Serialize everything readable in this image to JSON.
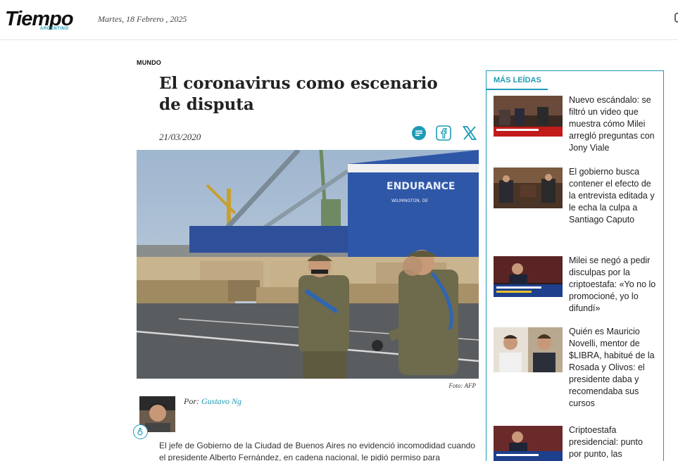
{
  "header": {
    "logo_text": "Tiempo",
    "logo_subtext": "ARGENTINO",
    "date": "Martes, 18 Febrero , 2025"
  },
  "article": {
    "section": "MUNDO",
    "title": "El coronavirus como escenario de disputa",
    "date": "21/03/2020",
    "image_caption": "Foto: AFP",
    "image_ship_name": "ENDURANCE",
    "image_ship_port": "WILMINGTON, DE",
    "author_prefix": "Por:",
    "author_name": "Gustavo Ng",
    "body": "El jefe de Gobierno de la Ciudad de Buenos Aires no evidenció incomodidad cuando el presidente Alberto Fernández, en cadena nacional, le pidió permiso para"
  },
  "share": {
    "icons": [
      "comments-icon",
      "facebook-icon",
      "x-icon"
    ]
  },
  "sidebar": {
    "title": "MÁS LEÍDAS",
    "items": [
      {
        "text": "Nuevo escándalo: se filtró un video que muestra cómo Milei arregló preguntas con Jony Viale"
      },
      {
        "text": "El gobierno busca contener el efecto de la entrevista editada y le echa la culpa a Santiago Caputo"
      },
      {
        "text": "Milei se negó a pedir disculpas por la criptoestafa: «Yo no lo promocioné, yo lo difundí»"
      },
      {
        "text": "Quién es Mauricio Novelli, mentor de $LIBRA, habitué de la Rosada y Olivos: el presidente daba y recomendaba sus cursos"
      },
      {
        "text": "Criptoestafa presidencial: punto por punto, las"
      }
    ]
  },
  "colors": {
    "accent": "#1d9bb5",
    "text": "#222222"
  }
}
